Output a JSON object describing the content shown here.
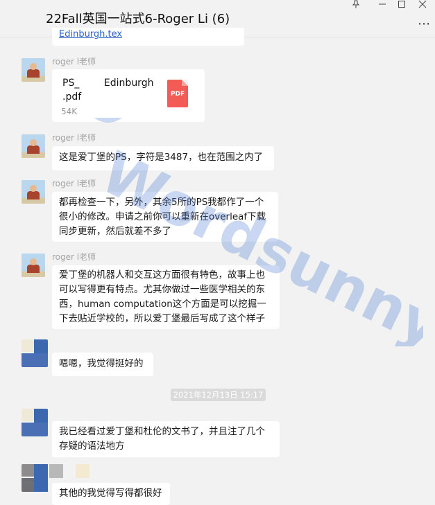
{
  "window": {
    "title": "22Fall英国一站式6-Roger Li (6)",
    "pin_icon": "pin-icon",
    "minimize_icon": "minimize-icon",
    "maximize_icon": "maximize-icon",
    "close_icon": "close-icon",
    "more_icon": "more-icon"
  },
  "top_partial": {
    "text": "Edinburgh.tex"
  },
  "messages": [
    {
      "sender": "roger l老师",
      "type": "file",
      "file_name_line1": "PS_        Edinburgh",
      "file_name_line2": ".pdf",
      "file_size": "54K",
      "file_icon_label": "PDF"
    },
    {
      "sender": "roger l老师",
      "type": "text",
      "lines": [
        "这是爱丁堡的PS，字符是3487，也在范围之内了"
      ]
    },
    {
      "sender": "roger l老师",
      "type": "text",
      "lines": [
        "都再检查一下，另外，其余5所的PS我都作了一个",
        "很小的修改。申请之前你可以重新在overleaf下载",
        "同步更新，然后就差不多了"
      ]
    },
    {
      "sender": "roger l老师",
      "type": "text",
      "lines": [
        "爱丁堡的机器人和交互这方面很有特色，故事上也",
        "可以写得更有特点。尤其你做过一些医学相关的东",
        "西，human computation这个方面是可以挖掘一",
        "下去贴近学校的，所以爱丁堡最后写成了这个样子"
      ]
    },
    {
      "sender": "",
      "type": "text",
      "lines": [
        "嗯嗯，我觉得挺好的"
      ]
    },
    {
      "sender": "",
      "type": "timestamp",
      "text": "2021年12月13日 15:17"
    },
    {
      "sender": "",
      "type": "text",
      "lines": [
        "我已经看过爱丁堡和杜伦的文书了，并且注了几个",
        "存疑的语法地方"
      ]
    },
    {
      "sender": "",
      "type": "text",
      "lines": [
        "其他的我觉得写得都很好"
      ]
    }
  ],
  "watermark": {
    "text": "Wordsunny"
  },
  "colors": {
    "background": "#f2f2f2",
    "bubble": "#ffffff",
    "link": "#2a62c9",
    "pdf": "#f25c54",
    "watermark": "#3f73d1"
  }
}
